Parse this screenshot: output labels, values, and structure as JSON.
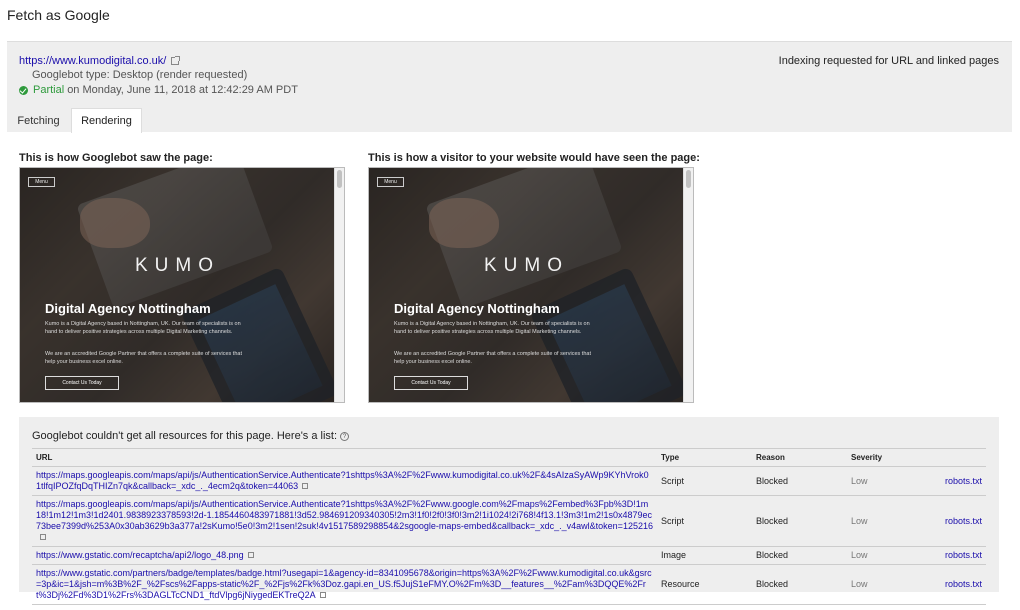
{
  "page_title": "Fetch as Google",
  "fetch": {
    "url": "https://www.kumodigital.co.uk/",
    "bot_type": "Googlebot type: Desktop (render requested)",
    "status": "Partial",
    "status_detail": "on Monday, June 11, 2018 at 12:42:29 AM PDT",
    "indexing": "Indexing requested for URL and linked pages"
  },
  "tabs": [
    {
      "label": "Fetching",
      "active": false
    },
    {
      "label": "Rendering",
      "active": true
    }
  ],
  "captions": {
    "left": "This is how Googlebot saw the page:",
    "right": "This is how a visitor to your website would have seen the page:"
  },
  "render": {
    "menu": "Menu",
    "logo": "KUMO",
    "hero_title": "Digital Agency Nottingham",
    "paragraph1": "Kumo is a Digital Agency based in Nottingham, UK. Our team of specialists is on hand to deliver positive strategies across multiple Digital Marketing channels.",
    "paragraph2": "We are an accredited Google Partner that offers a complete suite of services that help your business excel online.",
    "cta": "Contact Us Today"
  },
  "resources": {
    "header": "Googlebot couldn't get all resources for this page. Here's a list:",
    "columns": [
      "URL",
      "Type",
      "Reason",
      "Severity"
    ],
    "rows": [
      {
        "url": "https://maps.googleapis.com/maps/api/js/AuthenticationService.Authenticate?1shttps%3A%2F%2Fwww.kumodigital.co.uk%2F&4sAIzaSyAWp9KYhVrok01tlfqIPOZfqDqTHIZn7qk&callback=_xdc_._4ecm2q&token=44063",
        "type": "Script",
        "reason": "Blocked",
        "severity": "Low",
        "action": "robots.txt"
      },
      {
        "url": "https://maps.googleapis.com/maps/api/js/AuthenticationService.Authenticate?1shttps%3A%2F%2Fwww.google.com%2Fmaps%2Fembed%3Fpb%3D!1m18!1m12!1m3!1d2401.9838923378593!2d-1.1854460483971881!3d52.984691209340305!2m3!1f0!2f0!3f0!3m2!1i1024!2i768!4f13.1!3m3!1m2!1s0x4879ec73bee7399d%253A0x30ab3629b3a377a!2sKumo!5e0!3m2!1sen!2suk!4v1517589298854&2sgoogle-maps-embed&callback=_xdc_._v4awl&token=125216",
        "type": "Script",
        "reason": "Blocked",
        "severity": "Low",
        "action": "robots.txt"
      },
      {
        "url": "https://www.gstatic.com/recaptcha/api2/logo_48.png",
        "type": "Image",
        "reason": "Blocked",
        "severity": "Low",
        "action": "robots.txt"
      },
      {
        "url": "https://www.gstatic.com/partners/badge/templates/badge.html?usegapi=1&agency-id=8341095678&origin=https%3A%2F%2Fwww.kumodigital.co.uk&gsrc=3p&ic=1&jsh=m%3B%2F_%2Fscs%2Fapps-static%2F_%2Fjs%2Fk%3Doz.gapi.en_US.f5JujS1eFMY.O%2Fm%3D__features__%2Fam%3DQQE%2Frt%3Dj%2Fd%3D1%2Frs%3DAGLTcCND1_ftdVlpg6jNiygedEKTreQ2A",
        "type": "Resource",
        "reason": "Blocked",
        "severity": "Low",
        "action": "robots.txt"
      }
    ]
  }
}
